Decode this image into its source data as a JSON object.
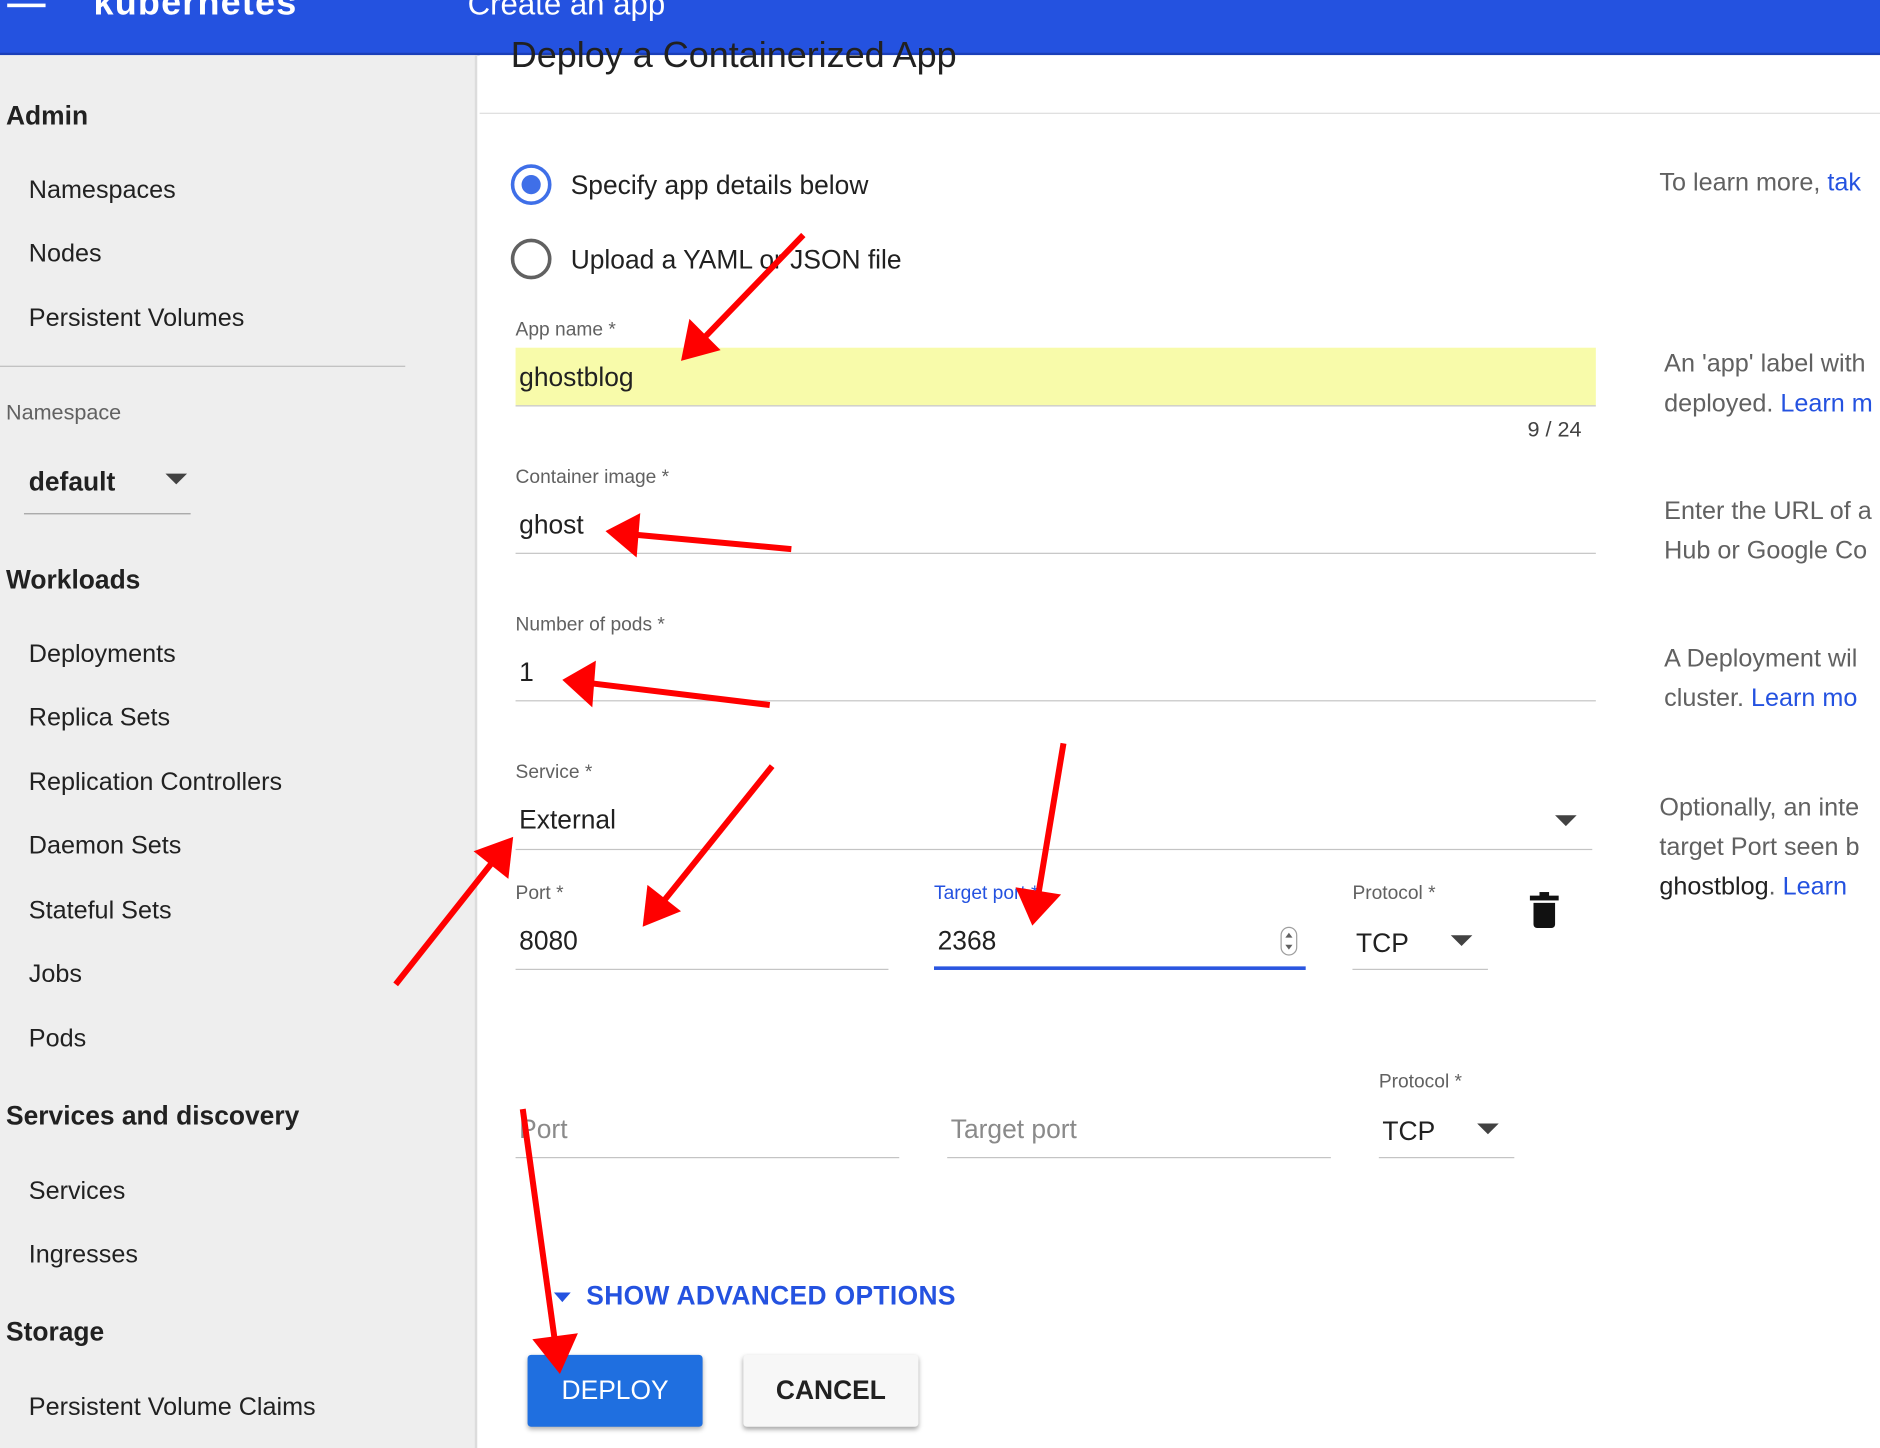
{
  "header": {
    "brand": "kubernetes",
    "title": "Create an app"
  },
  "sidebar": {
    "admin_heading": "Admin",
    "admin_items": [
      "Namespaces",
      "Nodes",
      "Persistent Volumes"
    ],
    "namespace_label": "Namespace",
    "namespace_value": "default",
    "workloads_heading": "Workloads",
    "workload_items": [
      "Deployments",
      "Replica Sets",
      "Replication Controllers",
      "Daemon Sets",
      "Stateful Sets",
      "Jobs",
      "Pods"
    ],
    "services_heading": "Services and discovery",
    "service_items": [
      "Services",
      "Ingresses"
    ],
    "storage_heading": "Storage",
    "storage_items": [
      "Persistent Volume Claims"
    ]
  },
  "main": {
    "page_heading": "Deploy a Containerized App",
    "mode_options": [
      {
        "label": "Specify app details below",
        "selected": true
      },
      {
        "label": "Upload a YAML or JSON file",
        "selected": false
      }
    ],
    "app_name": {
      "label": "App name *",
      "value": "ghostblog",
      "counter": "9 / 24"
    },
    "container_image": {
      "label": "Container image *",
      "value": "ghost"
    },
    "pods": {
      "label": "Number of pods *",
      "value": "1"
    },
    "service": {
      "label": "Service *",
      "value": "External"
    },
    "port_row_1": {
      "port_label": "Port *",
      "port_value": "8080",
      "target_label": "Target port *",
      "target_value": "2368",
      "protocol_label": "Protocol *",
      "protocol_value": "TCP"
    },
    "port_row_2": {
      "port_placeholder": "Port",
      "target_placeholder": "Target port",
      "protocol_label": "Protocol *",
      "protocol_value": "TCP"
    },
    "advanced_label": "SHOW ADVANCED OPTIONS",
    "deploy_label": "DEPLOY",
    "cancel_label": "CANCEL"
  },
  "help": {
    "intro": "To learn more,",
    "intro_link": "tak",
    "app_name_1": "An 'app' label with",
    "app_name_2": "deployed.",
    "app_name_link": "Learn m",
    "image_1": "Enter the URL of a",
    "image_2": "Hub or Google Co",
    "pods_1": "A Deployment wil",
    "pods_2": "cluster.",
    "pods_link": "Learn mo",
    "service_1": "Optionally, an inte",
    "service_2": "target Port seen b",
    "service_3": "ghostblog",
    "service_3_sep": ".",
    "service_link": "Learn"
  },
  "colors": {
    "header": "#2452e0",
    "accent": "#2452e0",
    "deploy_button": "#1f6fe0",
    "highlight": "#f8fbaa",
    "annotation_arrow": "#ff0000"
  }
}
